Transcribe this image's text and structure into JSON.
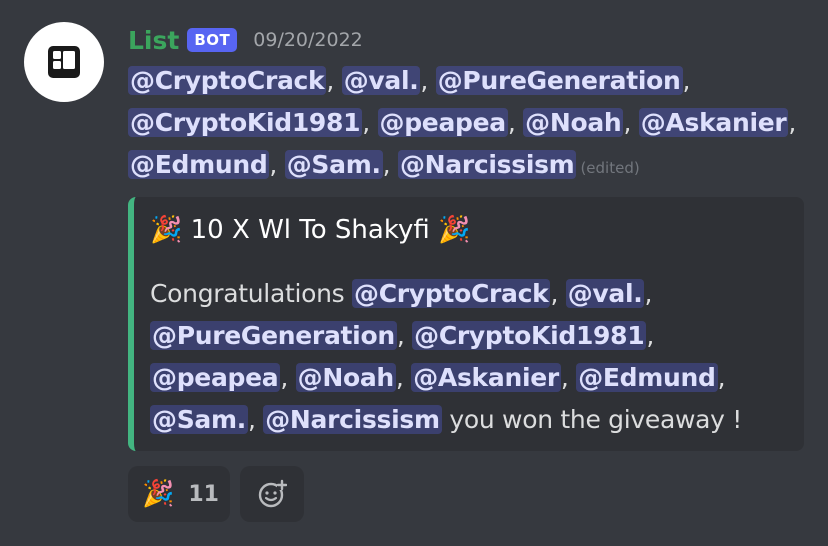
{
  "message": {
    "author": "List",
    "bot_tag": "BOT",
    "timestamp": "09/20/2022",
    "mentions_line": [
      [
        "@CryptoCrack",
        "@val.",
        "@PureGeneration"
      ],
      [
        "@CryptoKid1981",
        "@peapea",
        "@Noah",
        "@Askanier"
      ],
      [
        "@Edmund",
        "@Sam.",
        "@Narcissism"
      ]
    ],
    "edited_label": "(edited)"
  },
  "embed": {
    "title": "10 X Wl To Shakyfi",
    "title_emoji": "🎉",
    "desc_prefix": "Congratulations",
    "desc_mentions": [
      "@CryptoCrack",
      "@val.",
      "@PureGeneration",
      "@CryptoKid1981",
      "@peapea",
      "@Noah",
      "@Askanier",
      "@Edmund",
      "@Sam.",
      "@Narcissism"
    ],
    "desc_suffix": "you won the giveaway !",
    "accent_color": "#43b581"
  },
  "reactions": [
    {
      "emoji": "🎉",
      "count": "11"
    }
  ],
  "icons": {
    "add_reaction": "add-reaction-icon",
    "avatar": "list-bot-logo-icon"
  }
}
